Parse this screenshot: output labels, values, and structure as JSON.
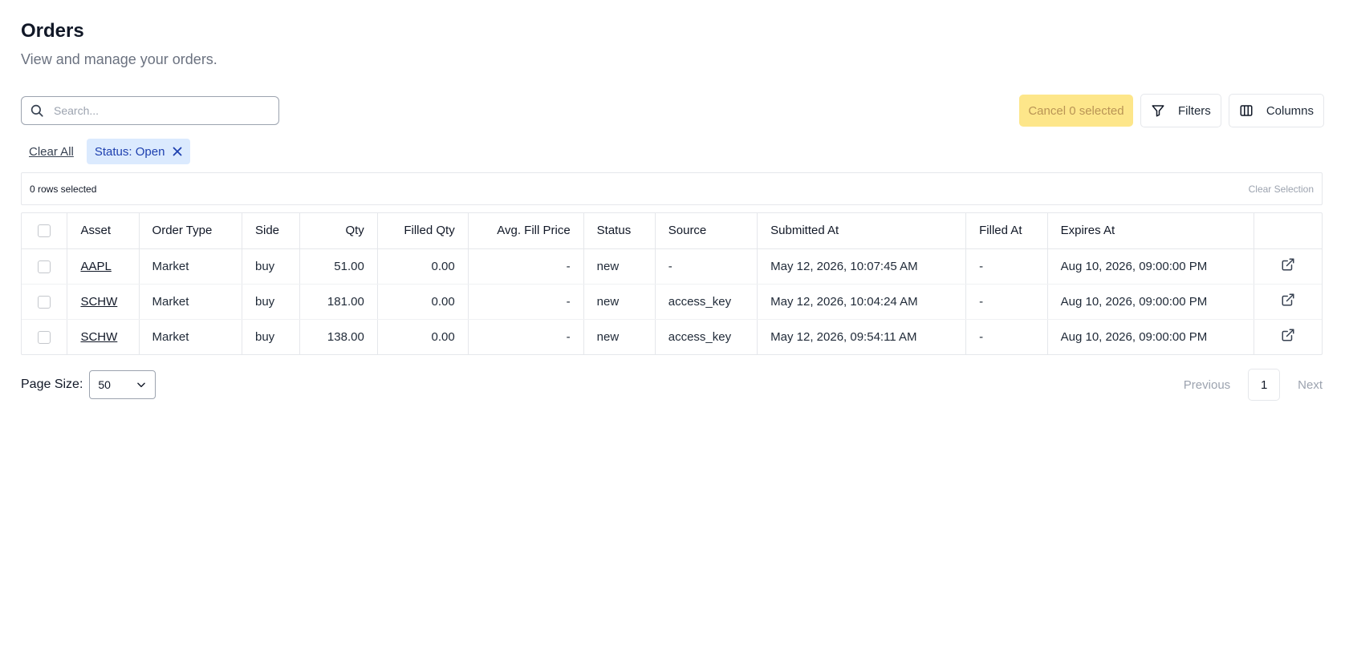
{
  "header": {
    "title": "Orders",
    "subtitle": "View and manage your orders."
  },
  "search": {
    "placeholder": "Search...",
    "value": "",
    "icon": "search-icon"
  },
  "actions": {
    "cancel_label": "Cancel 0 selected",
    "filters_label": "Filters",
    "filters_icon": "filter-icon",
    "columns_label": "Columns",
    "columns_icon": "columns-icon"
  },
  "active_filters": {
    "clear_all_label": "Clear All",
    "chips": [
      {
        "label": "Status: Open",
        "icon": "close-icon"
      }
    ]
  },
  "selection": {
    "count_label": "0 rows selected",
    "clear_label": "Clear Selection"
  },
  "table": {
    "columns": [
      "Asset",
      "Order Type",
      "Side",
      "Qty",
      "Filled Qty",
      "Avg. Fill Price",
      "Status",
      "Source",
      "Submitted At",
      "Filled At",
      "Expires At"
    ],
    "rows": [
      {
        "asset": "AAPL",
        "order_type": "Market",
        "side": "buy",
        "qty": "51.00",
        "filled_qty": "0.00",
        "avg_fill_price": "-",
        "status": "new",
        "source": "-",
        "submitted_at": "May 12, 2026, 10:07:45 AM",
        "filled_at": "-",
        "expires_at": "Aug 10, 2026, 09:00:00 PM"
      },
      {
        "asset": "SCHW",
        "order_type": "Market",
        "side": "buy",
        "qty": "181.00",
        "filled_qty": "0.00",
        "avg_fill_price": "-",
        "status": "new",
        "source": "access_key",
        "submitted_at": "May 12, 2026, 10:04:24 AM",
        "filled_at": "-",
        "expires_at": "Aug 10, 2026, 09:00:00 PM"
      },
      {
        "asset": "SCHW",
        "order_type": "Market",
        "side": "buy",
        "qty": "138.00",
        "filled_qty": "0.00",
        "avg_fill_price": "-",
        "status": "new",
        "source": "access_key",
        "submitted_at": "May 12, 2026, 09:54:11 AM",
        "filled_at": "-",
        "expires_at": "Aug 10, 2026, 09:00:00 PM"
      }
    ],
    "row_action_icon": "external-link-icon"
  },
  "pagination": {
    "page_size_label": "Page Size:",
    "page_size_value": "50",
    "previous_label": "Previous",
    "current_page": "1",
    "next_label": "Next"
  },
  "colors": {
    "cancel_bg": "#fde68a",
    "cancel_text": "#b99455",
    "chip_bg": "#dbeafe",
    "chip_text": "#1e40af"
  }
}
